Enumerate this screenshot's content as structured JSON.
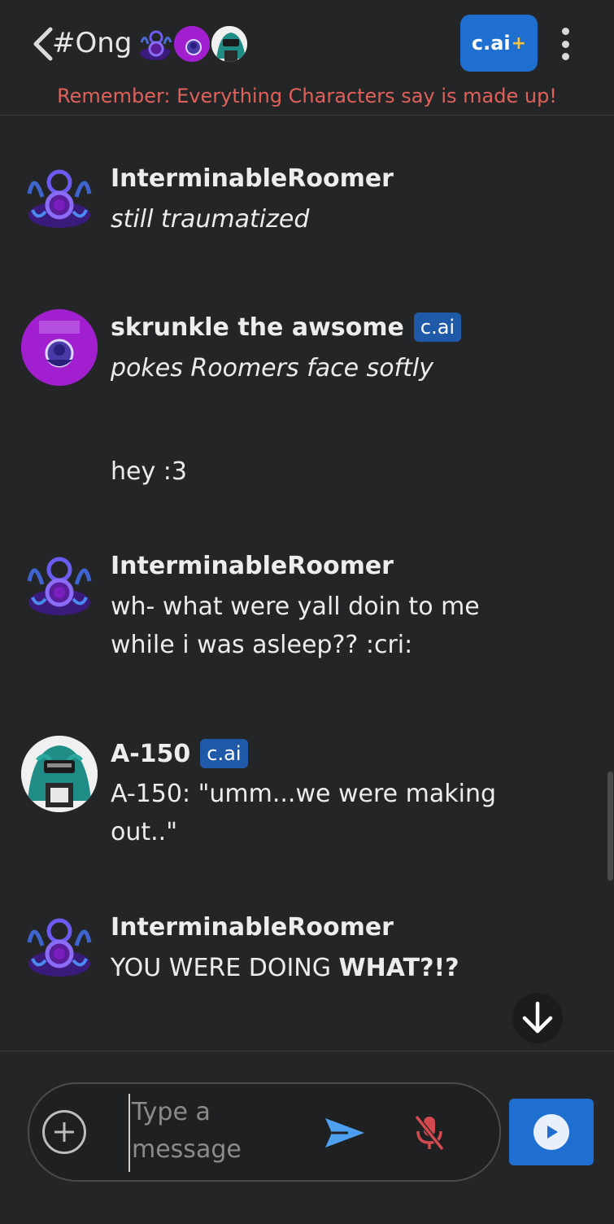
{
  "header": {
    "room_title": "#Ong",
    "plus_label": "c.ai",
    "plus_sign": "+",
    "disclaimer": "Remember: Everything Characters say is made up!"
  },
  "badge_label": "c.ai",
  "messages": [
    {
      "author": "InterminableRoomer",
      "text": "still traumatized",
      "italic": true,
      "avatar": "roomer-avatar"
    },
    {
      "author": "skrunkle the awsome",
      "badge": "c.ai",
      "text": "pokes Roomers face softly",
      "italic": true,
      "avatar": "skrunkle-avatar"
    },
    {
      "author": "",
      "text": "hey :3"
    },
    {
      "author": "InterminableRoomer",
      "text_line1": "wh- what were yall doin to me",
      "text_line2": "while i was asleep?? :cri:",
      "avatar": "roomer-avatar"
    },
    {
      "author": "A-150",
      "badge": "c.ai",
      "text_line1": "A-150: \"umm...we were making",
      "text_line2": "out..\"",
      "avatar": "a150-avatar"
    },
    {
      "author": "InterminableRoomer",
      "text_plain": "YOU WERE DOING ",
      "text_bold": "WHAT?!?",
      "avatar": "roomer-avatar"
    }
  ],
  "composer": {
    "placeholder": "Type a message"
  },
  "colors": {
    "background": "#242526",
    "accent_blue": "#1f6fd0",
    "disclaimer_red": "#e0605a",
    "mic_red": "#d24a4f",
    "send_blue": "#4f9ff0"
  },
  "icons": [
    "back-chevron-icon",
    "kebab-menu-icon",
    "arrow-down-icon",
    "add-icon",
    "send-icon",
    "mic-off-icon",
    "play-icon"
  ]
}
